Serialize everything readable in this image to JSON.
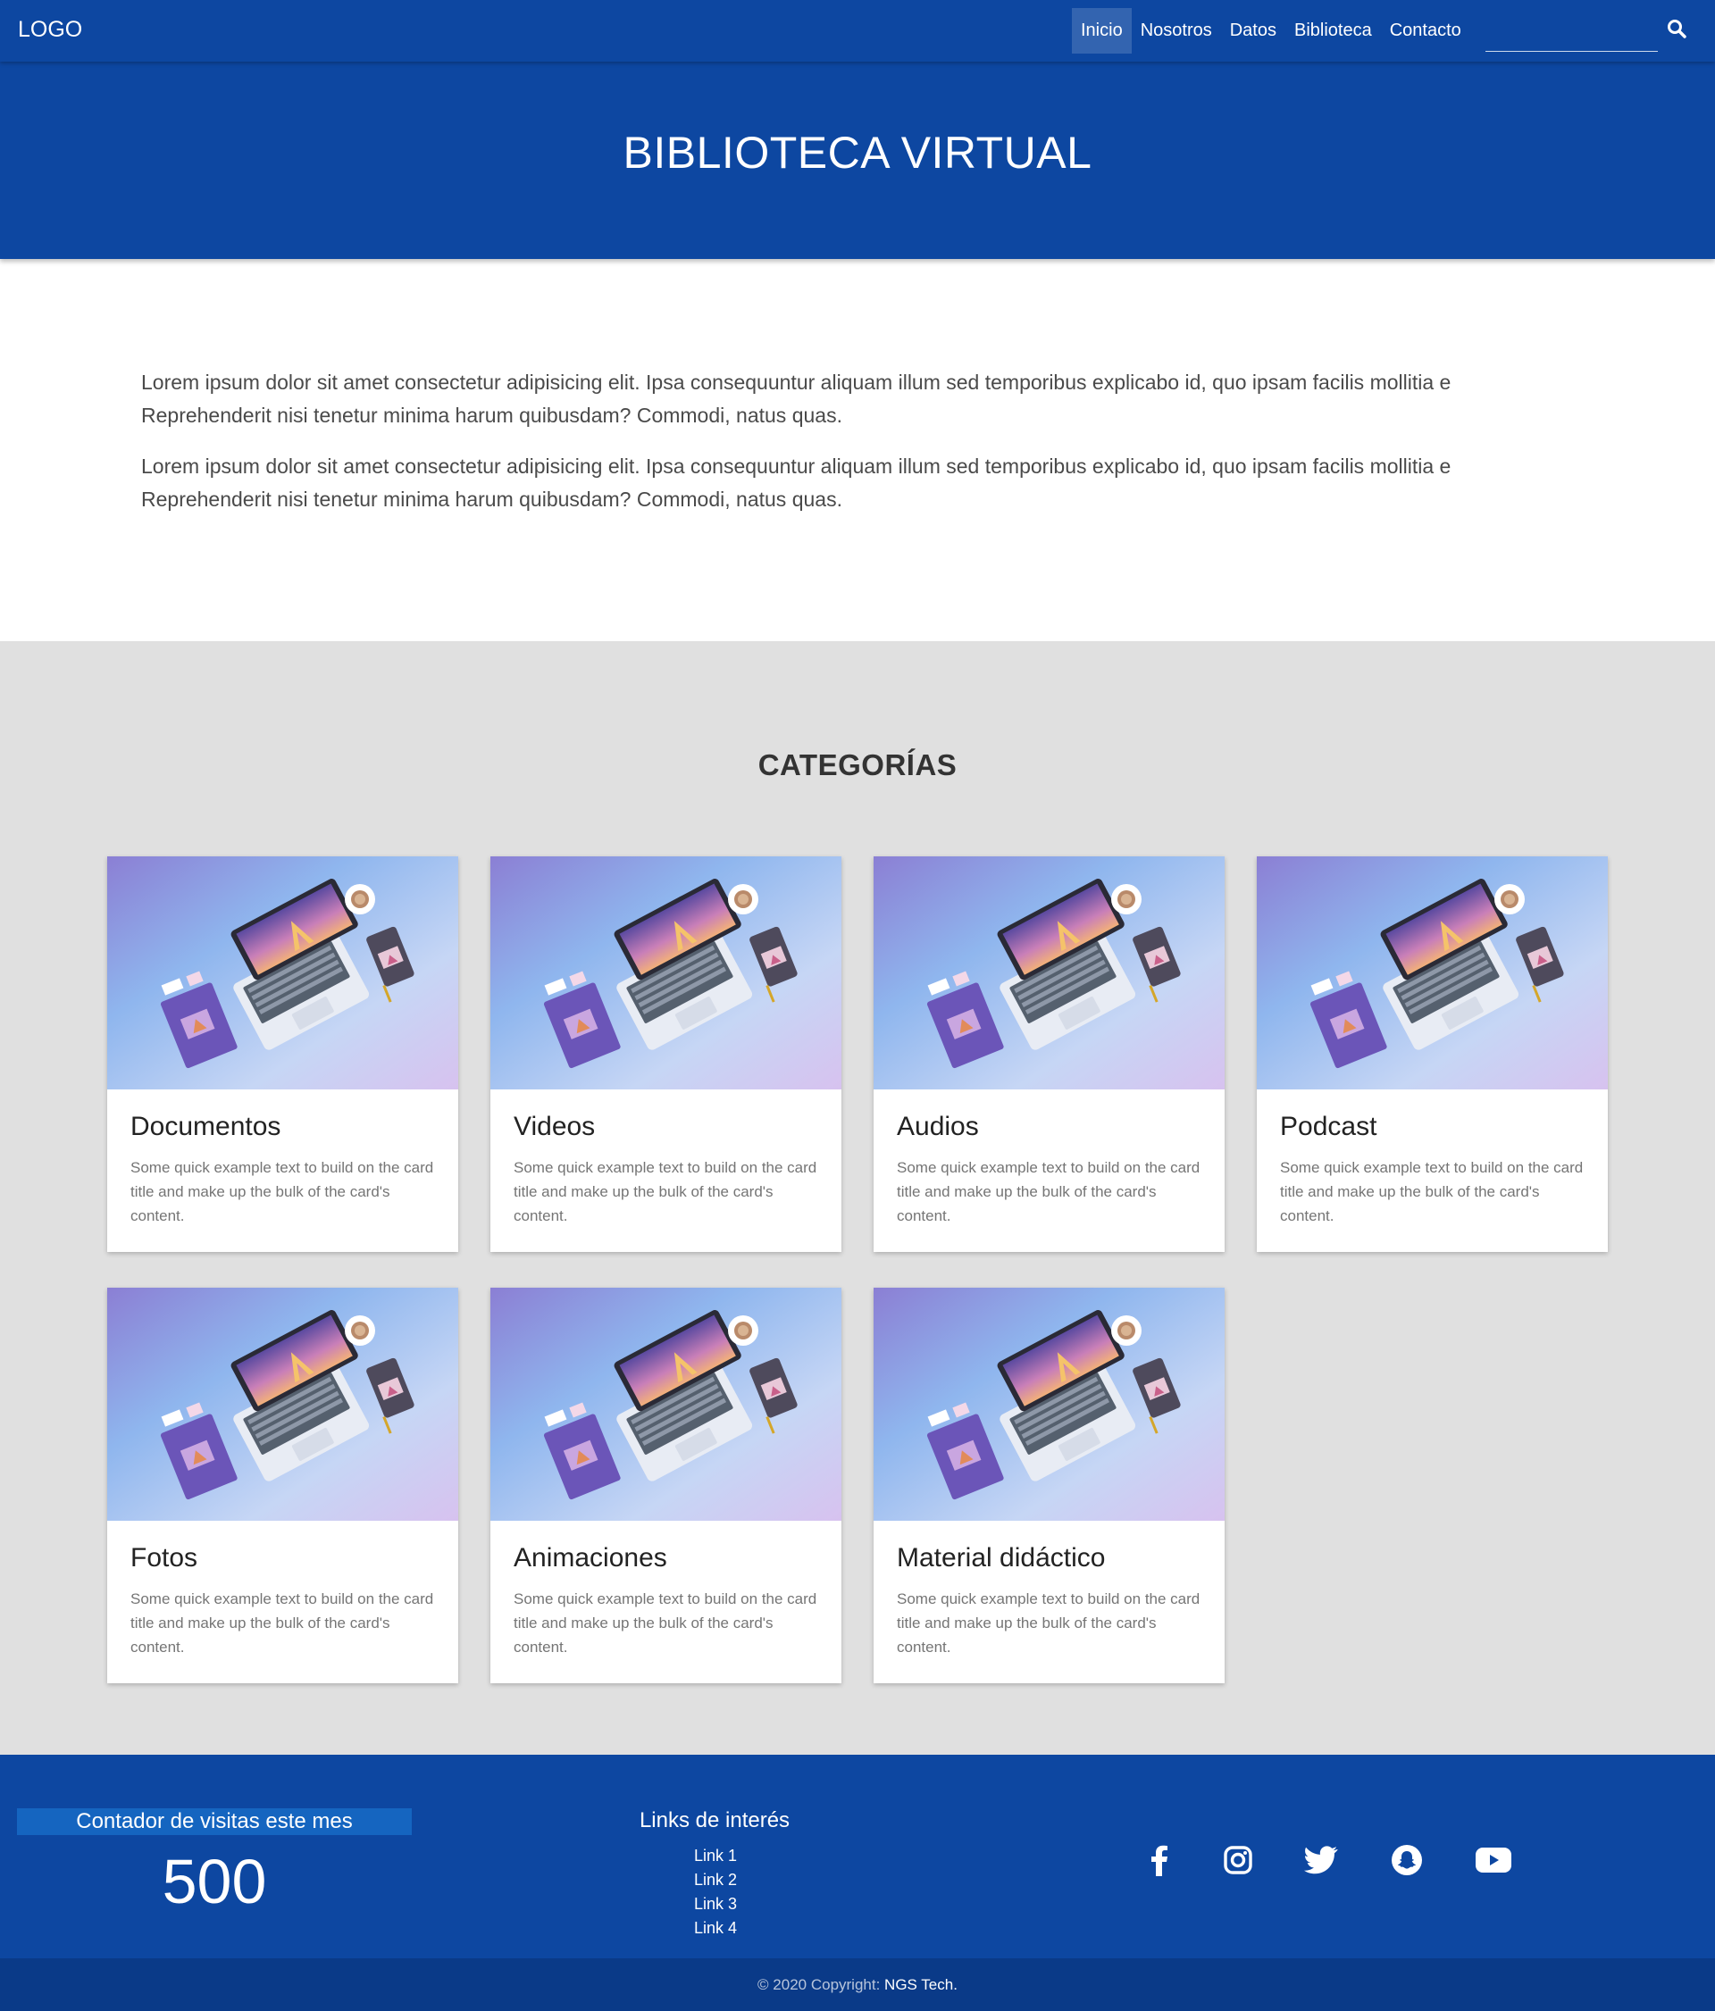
{
  "navbar": {
    "logo": "LOGO",
    "links": [
      "Inicio",
      "Nosotros",
      "Datos",
      "Biblioteca",
      "Contacto"
    ],
    "active": "Inicio",
    "search_placeholder": "",
    "search_icon": "search-icon"
  },
  "hero": {
    "title": "BIBLIOTECA VIRTUAL"
  },
  "intro": {
    "paragraphs": [
      "Lorem ipsum dolor sit amet consectetur adipisicing elit. Ipsa consequuntur aliquam illum sed temporibus explicabo id, quo ipsam facilis mollitia e",
      "Reprehenderit nisi tenetur minima harum quibusdam? Commodi, natus quas.",
      "Lorem ipsum dolor sit amet consectetur adipisicing elit. Ipsa consequuntur aliquam illum sed temporibus explicabo id, quo ipsam facilis mollitia e",
      "Reprehenderit nisi tenetur minima harum quibusdam? Commodi, natus quas."
    ]
  },
  "categories": {
    "title": "CATEGORÍAS",
    "cards": [
      {
        "title": "Documentos",
        "text": "Some quick example text to build on the card title and make up the bulk of the card's content."
      },
      {
        "title": "Videos",
        "text": "Some quick example text to build on the card title and make up the bulk of the card's content."
      },
      {
        "title": "Audios",
        "text": "Some quick example text to build on the card title and make up the bulk of the card's content."
      },
      {
        "title": "Podcast",
        "text": "Some quick example text to build on the card title and make up the bulk of the card's content."
      },
      {
        "title": "Fotos",
        "text": "Some quick example text to build on the card title and make up the bulk of the card's content."
      },
      {
        "title": "Animaciones",
        "text": "Some quick example text to build on the card title and make up the bulk of the card's content."
      },
      {
        "title": "Material didáctico",
        "text": "Some quick example text to build on the card title and make up the bulk of the card's content."
      }
    ]
  },
  "footer": {
    "counter_label": "Contador de visitas este mes",
    "counter_value": "500",
    "links_title": "Links de interés",
    "links": [
      "Link 1",
      "Link 2",
      "Link 3",
      "Link 4"
    ],
    "social_icons": [
      "facebook-icon",
      "instagram-icon",
      "twitter-icon",
      "snapchat-icon",
      "youtube-icon"
    ]
  },
  "copyright": {
    "prefix": "© 2020 Copyright: ",
    "brand": "NGS Tech."
  },
  "colors": {
    "primary": "#0d47a1",
    "primary_dark": "#0a3a88",
    "section_bg": "#e0e0e0",
    "counter_bg": "#1565c0"
  }
}
